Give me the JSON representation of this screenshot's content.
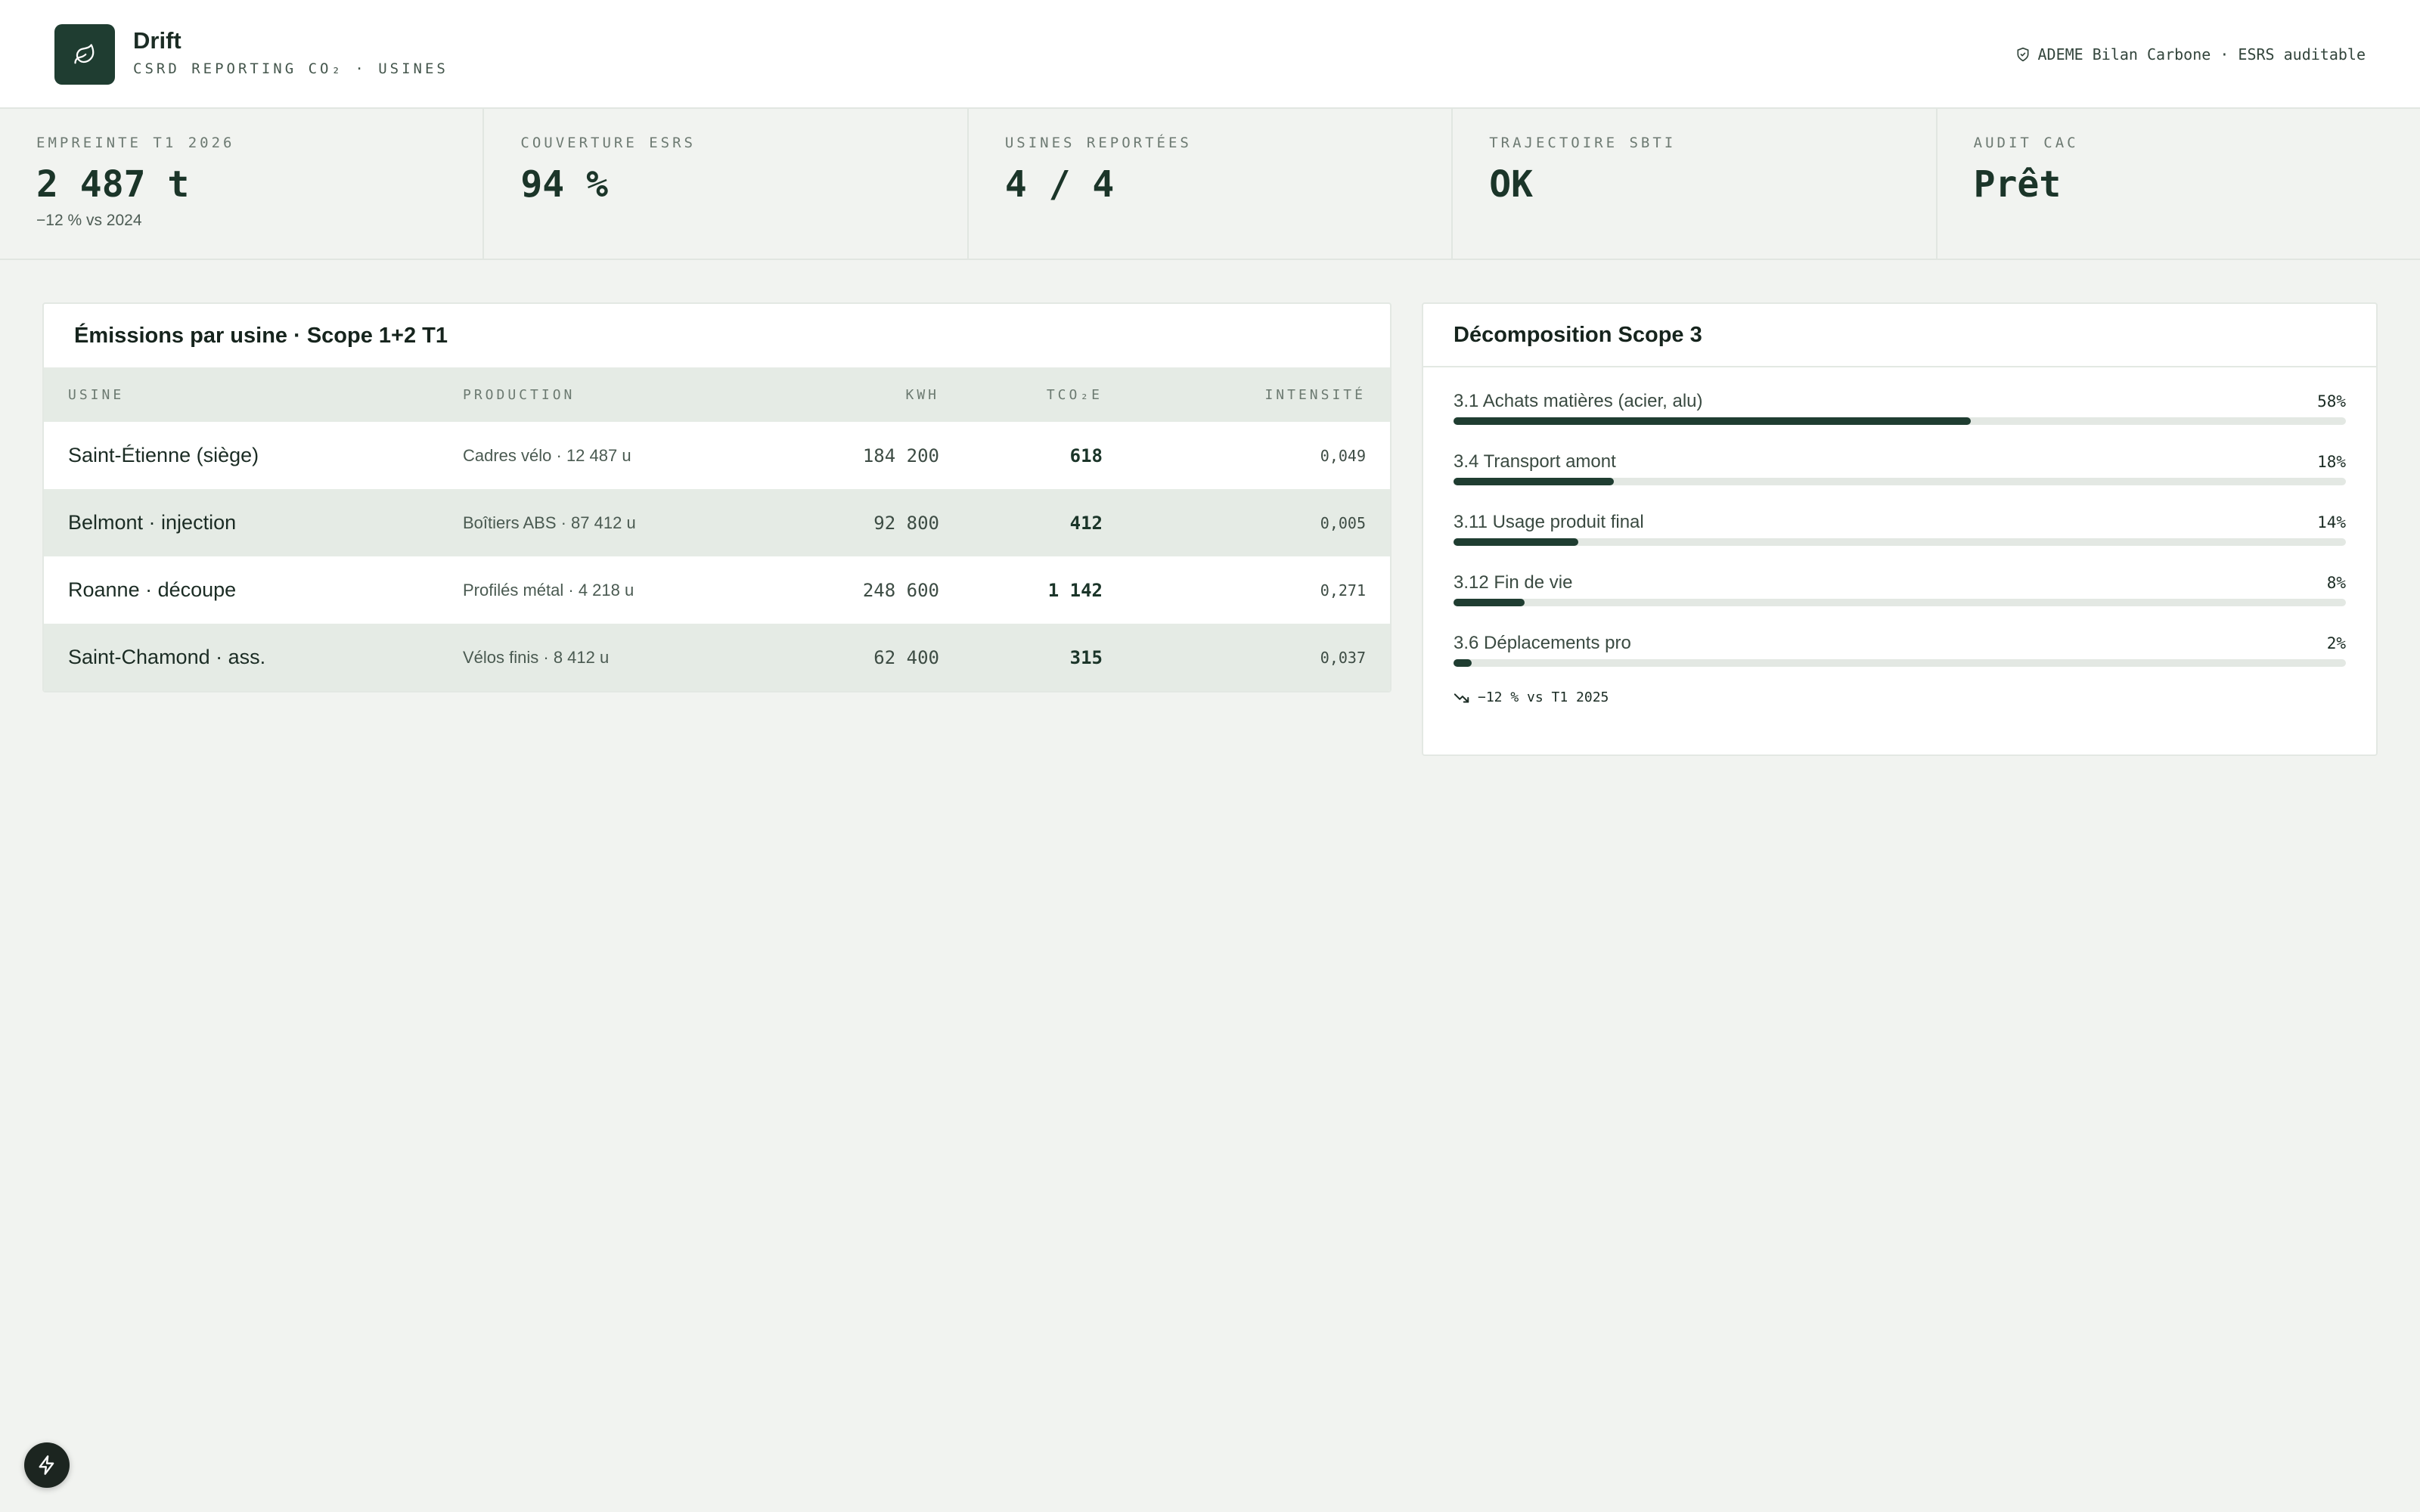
{
  "header": {
    "app_name": "Drift",
    "app_subtitle": "CSRD REPORTING CO₂ · USINES",
    "badge_text": "ADEME Bilan Carbone · ESRS auditable",
    "logo_icon": "leaf-icon",
    "badge_icon": "shield-check-icon"
  },
  "kpis": [
    {
      "label": "EMPREINTE T1 2026",
      "value": "2 487 t",
      "sub": "−12 % vs 2024"
    },
    {
      "label": "COUVERTURE ESRS",
      "value": "94 %",
      "sub": ""
    },
    {
      "label": "USINES REPORTÉES",
      "value": "4 / 4",
      "sub": ""
    },
    {
      "label": "TRAJECTOIRE SBTI",
      "value": "OK",
      "sub": ""
    },
    {
      "label": "AUDIT CAC",
      "value": "Prêt",
      "sub": ""
    }
  ],
  "emissions": {
    "title": "Émissions par usine · Scope 1+2 T1",
    "columns": [
      "USINE",
      "PRODUCTION",
      "KWH",
      "TCO₂E",
      "INTENSITÉ"
    ],
    "rows": [
      {
        "usine": "Saint-Étienne (siège)",
        "production": "Cadres vélo · 12 487 u",
        "kwh": "184 200",
        "tco2e": "618",
        "intensite": "0,049"
      },
      {
        "usine": "Belmont · injection",
        "production": "Boîtiers ABS · 87 412 u",
        "kwh": "92 800",
        "tco2e": "412",
        "intensite": "0,005"
      },
      {
        "usine": "Roanne · découpe",
        "production": "Profilés métal · 4 218 u",
        "kwh": "248 600",
        "tco2e": "1 142",
        "intensite": "0,271"
      },
      {
        "usine": "Saint-Chamond · ass.",
        "production": "Vélos finis · 8 412 u",
        "kwh": "62 400",
        "tco2e": "315",
        "intensite": "0,037"
      }
    ]
  },
  "scope3": {
    "title": "Décomposition Scope 3",
    "items": [
      {
        "label": "3.1 Achats matières (acier, alu)",
        "pct_text": "58%",
        "value": 58
      },
      {
        "label": "3.4 Transport amont",
        "pct_text": "18%",
        "value": 18
      },
      {
        "label": "3.11 Usage produit final",
        "pct_text": "14%",
        "value": 14
      },
      {
        "label": "3.12 Fin de vie",
        "pct_text": "8%",
        "value": 8
      },
      {
        "label": "3.6 Déplacements pro",
        "pct_text": "2%",
        "value": 2
      }
    ],
    "footer": "−12 % vs T1 2025",
    "footer_icon": "trend-down-icon"
  },
  "fab_icon": "bolt-icon",
  "colors": {
    "accent": "#1f3d31",
    "background": "#f1f3f0",
    "row_alt": "#e5ebe5"
  }
}
